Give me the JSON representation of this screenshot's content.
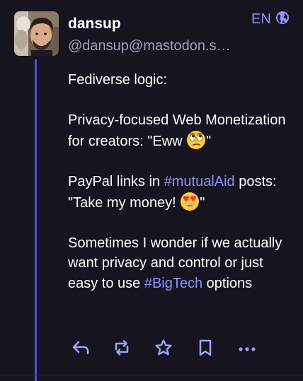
{
  "post": {
    "display_name": "dansup",
    "handle": "@dansup@mastodon.s…",
    "language": "EN",
    "visibility_icon": "globe-icon",
    "paragraphs": {
      "p1": "Fediverse logic:",
      "p2a": "Privacy-focused Web Monetization for creators: \"Eww ",
      "p2b": "\"",
      "p3a": "PayPal links in ",
      "p3_hashtag": "#mutualAid",
      "p3b": " posts: \"Take my money! ",
      "p3c": "\"",
      "p4a": "Sometimes I wonder if we actually want privacy and control or just easy to use ",
      "p4_hashtag": "#BigTech",
      "p4b": " options"
    },
    "emojis": [
      "rolling-eyes-emoji",
      "heart-eyes-emoji"
    ]
  },
  "actions": {
    "reply": "reply-icon",
    "boost": "boost-icon",
    "favourite": "star-icon",
    "bookmark": "bookmark-icon",
    "more": "more-icon"
  },
  "colors": {
    "background": "#16151f",
    "accent": "#8c92ff",
    "thread_line": "#595aff",
    "muted": "#9ca0b8",
    "icon": "#9ba3ff"
  }
}
